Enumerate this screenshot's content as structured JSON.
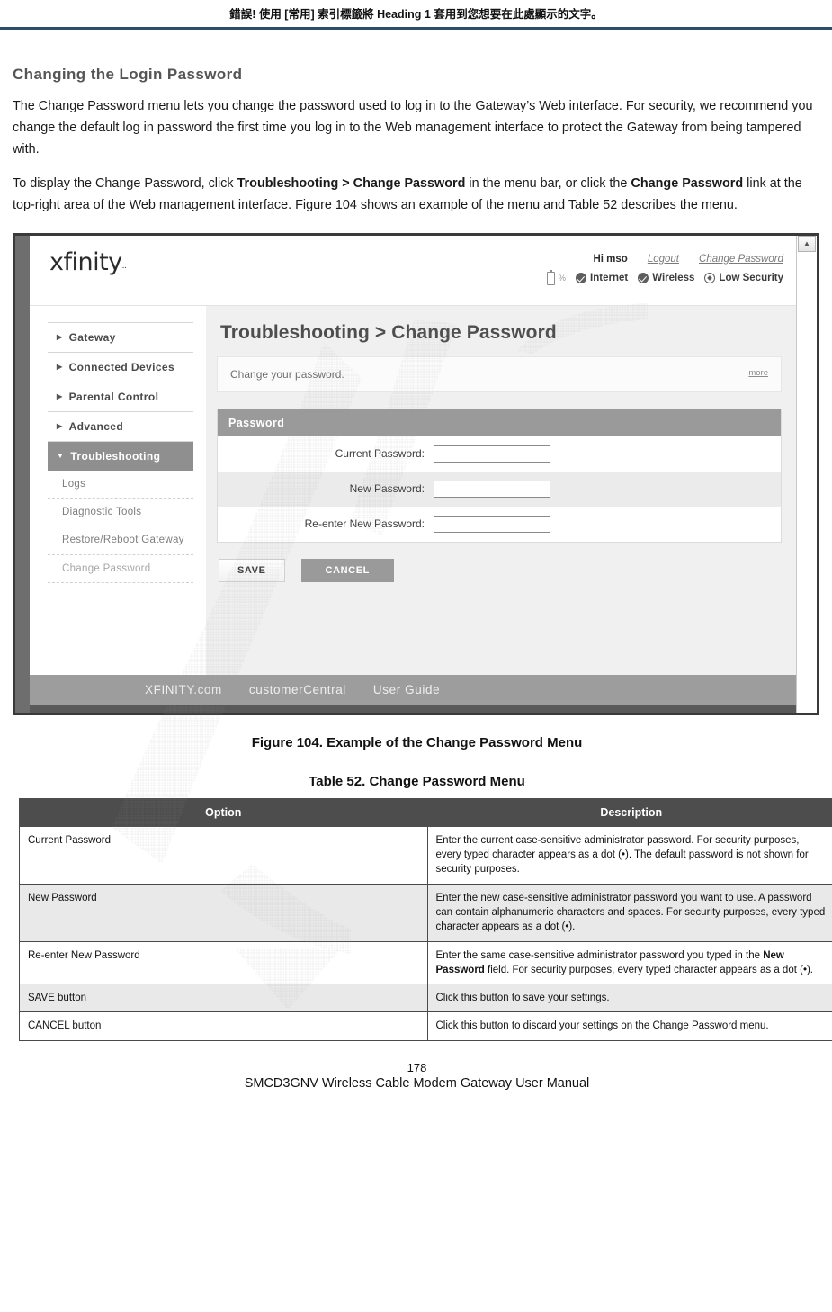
{
  "doc": {
    "running_header": "錯誤! 使用 [常用] 索引標籤將 Heading 1 套用到您想要在此處顯示的文字。",
    "section_title": "Changing the Login Password",
    "para1": "The Change Password menu lets you change the password used to log in to the Gateway’s Web interface. For security, we recommend you change the default log in password the first time you log in to the Web management interface to protect the Gateway from being tampered with.",
    "para2_a": "To display the Change Password, click ",
    "para2_b": "Troubleshooting > Change Password",
    "para2_c": " in the menu bar, or click the ",
    "para2_d": "Change Password",
    "para2_e": " link at the top-right area of the Web management interface. Figure 104 shows an example of the menu and Table 52 describes the menu.",
    "figure_caption": "Figure 104. Example of the Change Password Menu",
    "table_caption": "Table 52. Change Password Menu",
    "page_number": "178",
    "page_footer": "SMCD3GNV Wireless Cable Modem Gateway User Manual"
  },
  "screenshot": {
    "logo": "xfinity",
    "header": {
      "greeting": "Hi mso",
      "logout": "Logout",
      "change_password": "Change Password",
      "battery_pct": "%",
      "status": [
        {
          "label": "Internet",
          "icon": "check-circle-icon"
        },
        {
          "label": "Wireless",
          "icon": "check-circle-icon"
        },
        {
          "label": "Low Security",
          "icon": "shield-icon"
        }
      ]
    },
    "sidebar": {
      "items": [
        {
          "label": "Gateway",
          "active": false
        },
        {
          "label": "Connected Devices",
          "active": false
        },
        {
          "label": "Parental Control",
          "active": false
        },
        {
          "label": "Advanced",
          "active": false
        },
        {
          "label": "Troubleshooting",
          "active": true
        }
      ],
      "subitems": [
        {
          "label": "Logs",
          "dim": false
        },
        {
          "label": "Diagnostic Tools",
          "dim": false
        },
        {
          "label": "Restore/Reboot Gateway",
          "dim": false
        },
        {
          "label": "Change Password",
          "dim": true
        }
      ]
    },
    "content": {
      "title": "Troubleshooting > Change Password",
      "description": "Change your password.",
      "more_link": "more",
      "panel_title": "Password",
      "fields": [
        {
          "label": "Current Password:",
          "value": ""
        },
        {
          "label": "New Password:",
          "value": ""
        },
        {
          "label": "Re-enter New Password:",
          "value": ""
        }
      ],
      "save_button": "SAVE",
      "cancel_button": "CANCEL"
    },
    "footer_links": [
      "XFINITY.com",
      "customerCentral",
      "User Guide"
    ]
  },
  "table": {
    "headers": [
      "Option",
      "Description"
    ],
    "rows": [
      {
        "option": "Current Password",
        "desc": "Enter the current case-sensitive administrator password. For security purposes, every typed character appears as a dot (•). The default password is not shown for security purposes."
      },
      {
        "option": "New Password",
        "desc": "Enter the new case-sensitive administrator password you want to use. A password can contain alphanumeric characters and spaces. For security purposes, every typed character appears as a dot (•)."
      },
      {
        "option": "Re-enter New Password",
        "desc_a": "Enter the same case-sensitive administrator password you typed in the ",
        "desc_b": "New Password",
        "desc_c": " field. For security purposes, every typed character appears as a dot (•)."
      },
      {
        "option": "SAVE button",
        "desc": "Click this button to save your settings."
      },
      {
        "option": "CANCEL button",
        "desc": "Click this button to discard your settings on the Change Password menu."
      }
    ]
  },
  "colors": {
    "header_rule": "#2e4d6b",
    "table_header_bg": "#4d4d4d",
    "panel_head_bg": "#9a9a9a",
    "active_nav_bg": "#8f8f8f"
  }
}
